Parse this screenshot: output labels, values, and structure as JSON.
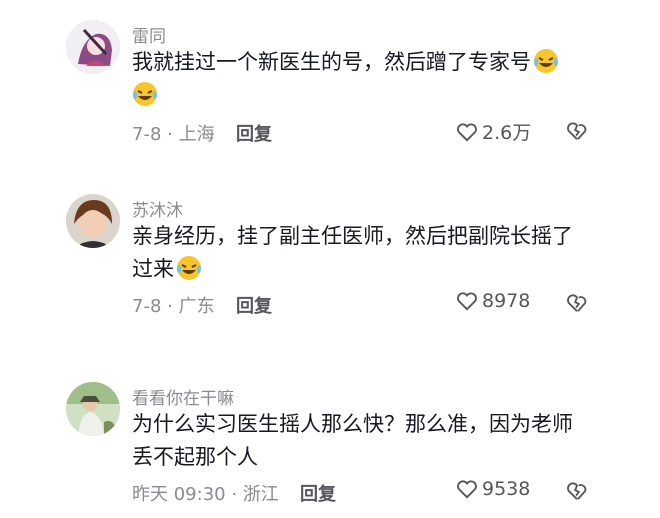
{
  "comments": [
    {
      "username": "雷同",
      "text": "我就挂过一个新医生的号，然后蹭了专家号",
      "emoji_count": 2,
      "meta": "7-8 · 上海",
      "reply_label": "回复",
      "likes": "2.6万",
      "avatar": "anime-character-avatar"
    },
    {
      "username": "苏沐沐",
      "text": "亲身经历，挂了副主任医师，然后把副院长摇了过来",
      "emoji_count": 1,
      "meta": "7-8 · 广东",
      "reply_label": "回复",
      "likes": "8978",
      "avatar": "person-photo-avatar"
    },
    {
      "username": "看看你在干嘛",
      "text": "为什么实习医生摇人那么快？那么准，因为老师丢不起那个人",
      "emoji_count": 0,
      "meta": "昨天 09:30 · 浙江",
      "reply_label": "回复",
      "likes": "9538",
      "avatar": "outdoor-photo-avatar"
    }
  ],
  "colors": {
    "text": "#161823",
    "secondary": "#8a8b91",
    "emoji": "#f8c52a"
  }
}
